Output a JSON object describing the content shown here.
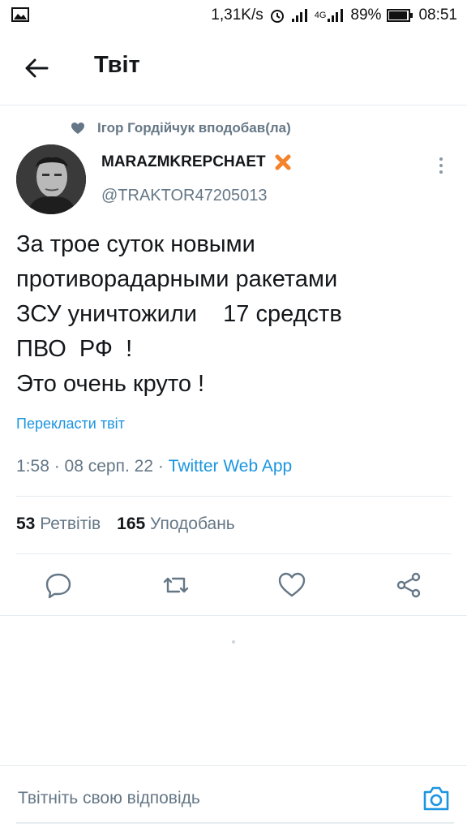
{
  "status_bar": {
    "speed": "1,31K/s",
    "network": "4G",
    "battery": "89%",
    "time": "08:51"
  },
  "header": {
    "title": "Твіт"
  },
  "context": {
    "text": "Ігор Гордійчук вподобав(ла)"
  },
  "author": {
    "name": "MARAZMKREPCHAET",
    "handle": "@TRAKTOR47205013"
  },
  "tweet": {
    "text": "За трое суток новыми\nпротиворадарными ракетами\nЗСУ уничтожили    17 средств\nПВО  РФ  !\nЭто очень круто !",
    "translate": "Перекласти твіт",
    "time": "1:58",
    "date": "08 серп. 22",
    "sep": " · ",
    "app": "Twitter Web App"
  },
  "stats": {
    "retweets_count": "53",
    "retweets_label": "Ретвітів",
    "likes_count": "165",
    "likes_label": "Уподобань"
  },
  "reply": {
    "placeholder": "Твітніть свою відповідь"
  },
  "colors": {
    "accent": "#1b95e0",
    "secondary_text": "#657786",
    "emoji_x": "#f4832b"
  }
}
